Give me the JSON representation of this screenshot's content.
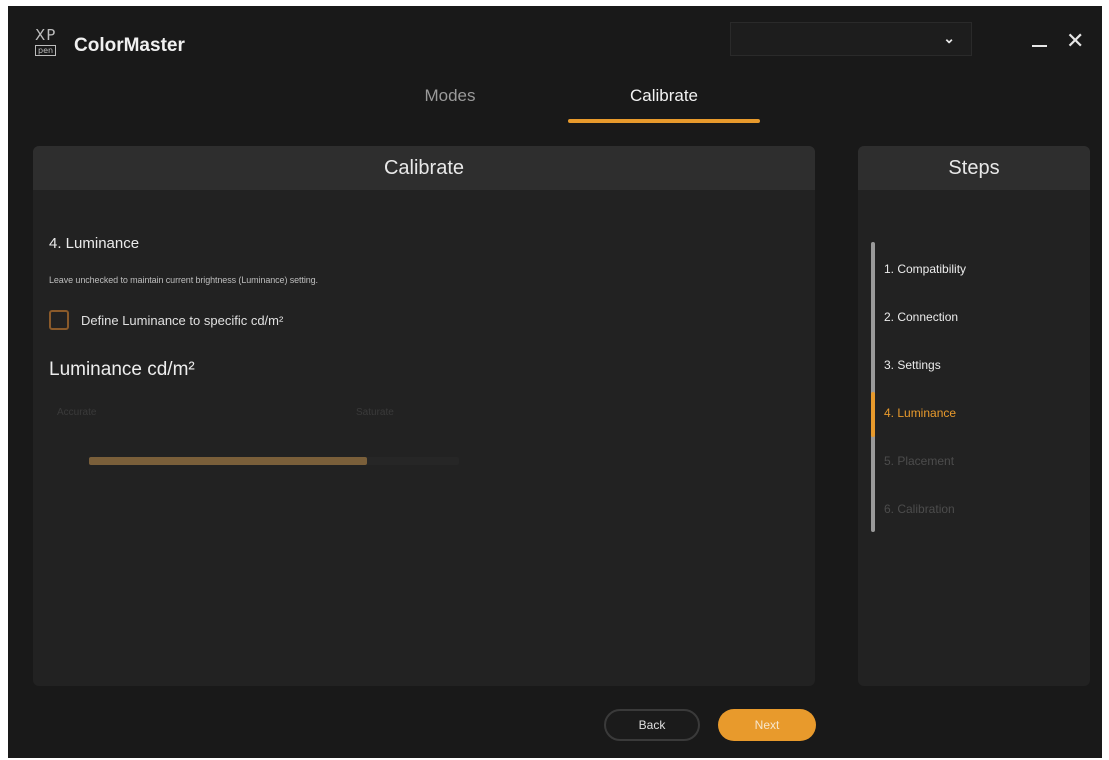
{
  "app": {
    "logo_top": "XP",
    "logo_bottom": "pen",
    "title": "ColorMaster"
  },
  "device_select": {
    "value": "",
    "chevron_icon": "chevron-down-icon"
  },
  "window_controls": {
    "minimize_icon": "minimize-icon",
    "close_icon": "close-icon",
    "close_glyph": "✕"
  },
  "tabs": [
    {
      "label": "Modes",
      "active": false
    },
    {
      "label": "Calibrate",
      "active": true
    }
  ],
  "main": {
    "header": "Calibrate",
    "section_title": "4. Luminance",
    "hint": "Leave unchecked to maintain current brightness (Luminance) setting.",
    "checkbox": {
      "label": "Define Luminance to specific cd/m²",
      "checked": false
    },
    "luminance_heading": "Luminance cd/m²",
    "slider": {
      "left_label": "Accurate",
      "right_label": "Saturate",
      "fill_fraction": 0.75,
      "enabled": false
    }
  },
  "steps": {
    "header": "Steps",
    "items": [
      {
        "label": "1. Compatibility",
        "state": "done"
      },
      {
        "label": "2. Connection",
        "state": "done"
      },
      {
        "label": "3. Settings",
        "state": "done"
      },
      {
        "label": "4. Luminance",
        "state": "active"
      },
      {
        "label": "5. Placement",
        "state": "pending"
      },
      {
        "label": "6. Calibration",
        "state": "pending"
      }
    ]
  },
  "footer": {
    "back_label": "Back",
    "next_label": "Next"
  },
  "colors": {
    "accent": "#e89a2c",
    "background": "#191919",
    "panel": "#222222",
    "panel_header": "#2e2e2e"
  }
}
